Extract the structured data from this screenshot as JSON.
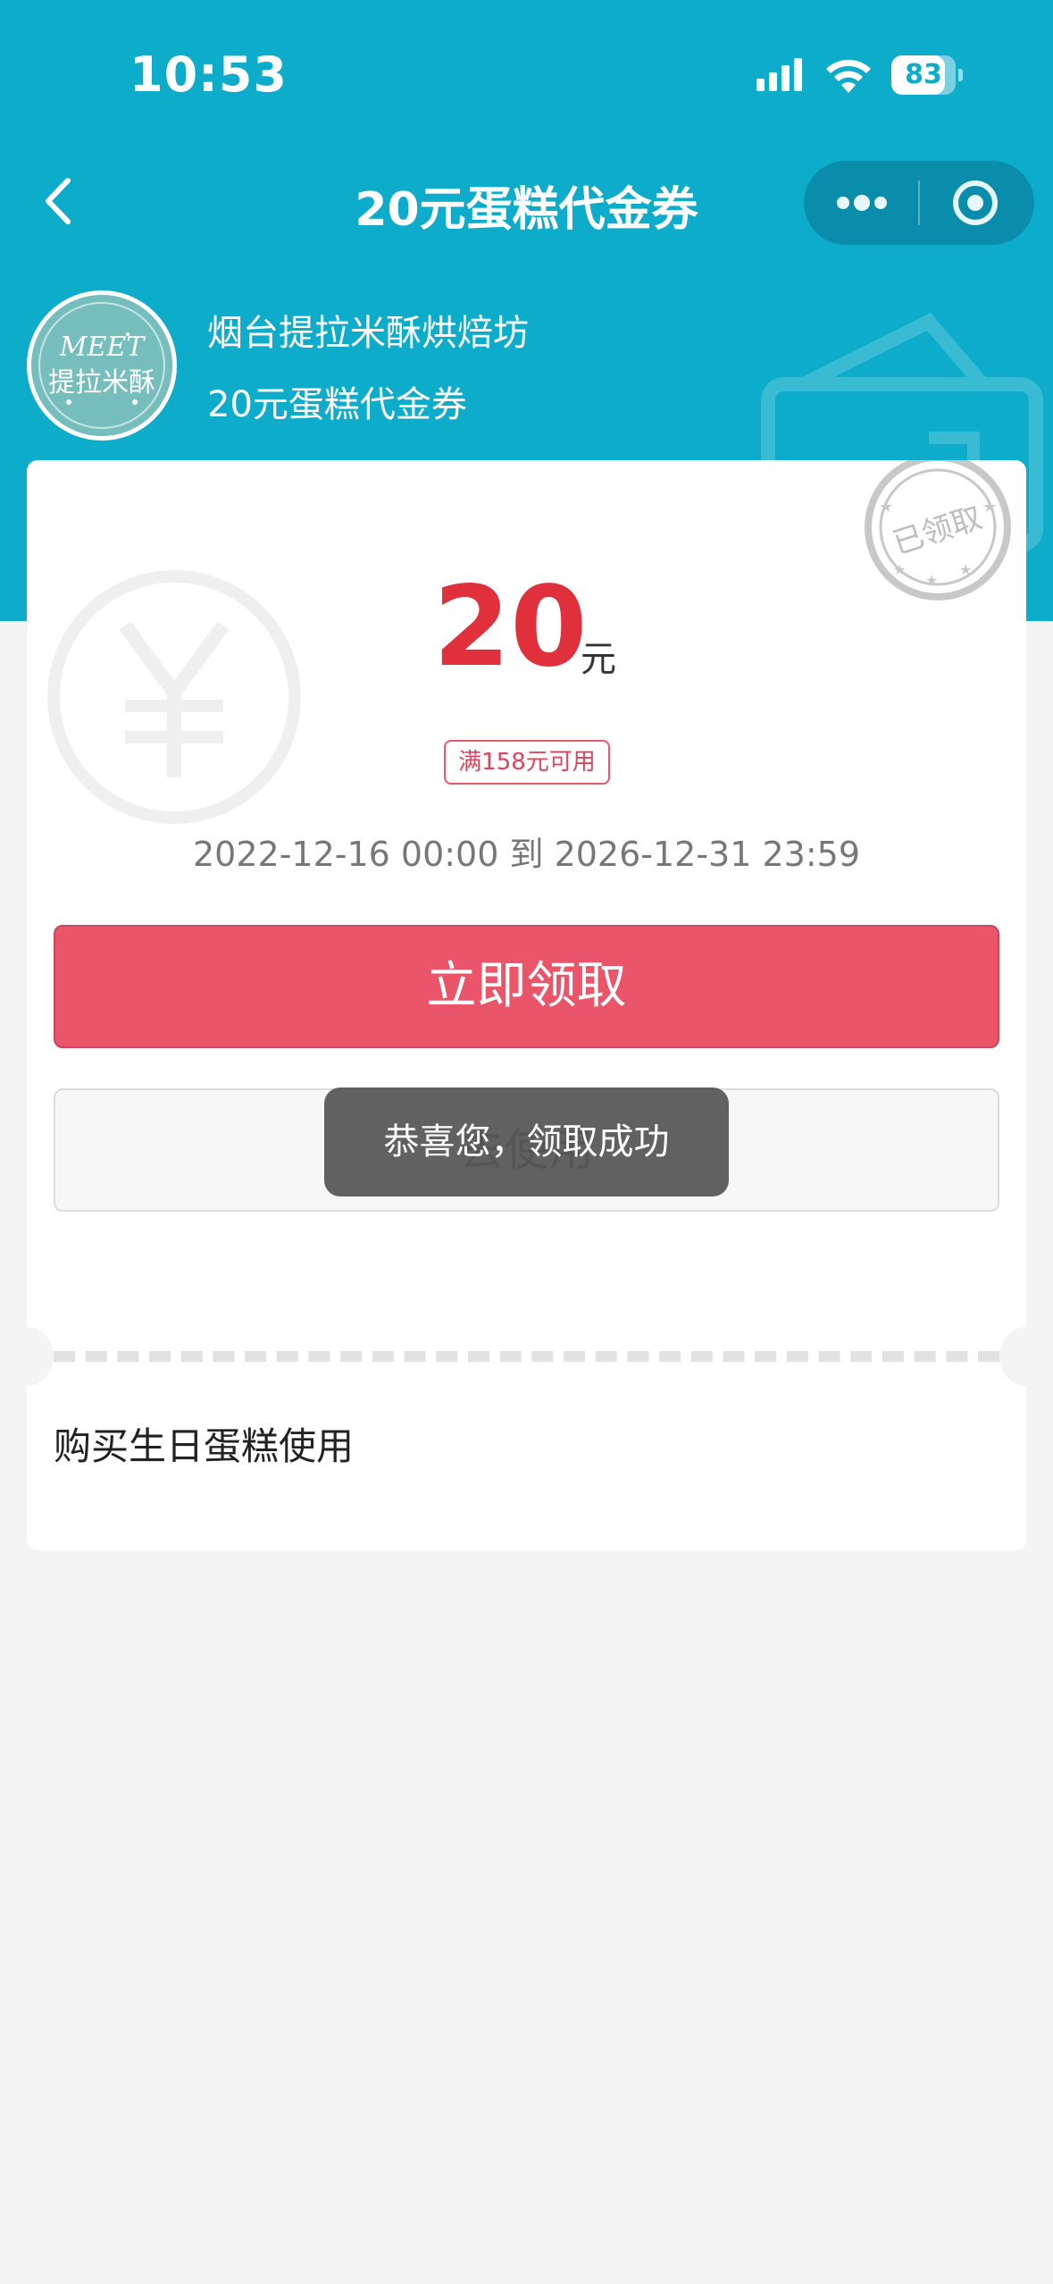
{
  "status_bar": {
    "time": "10:53",
    "battery_level": "83",
    "battery_fraction": 0.83
  },
  "nav": {
    "title": "20元蛋糕代金券",
    "back_icon": "chevron-left-icon",
    "more_icon": "more-dots-icon",
    "close_icon": "target-circle-icon"
  },
  "shop": {
    "name": "烟台提拉米酥烘焙坊",
    "subtitle": "20元蛋糕代金券",
    "logo_text": "MEET 提拉米酥"
  },
  "coupon": {
    "amount": "20",
    "unit": "元",
    "condition": "满158元可用",
    "validity": "2022-12-16 00:00 到 2026-12-31 23:59",
    "stamp_text": "已领取",
    "claim_label": "立即领取",
    "use_label": "去使用",
    "usage_description": "购买生日蛋糕使用"
  },
  "toast": {
    "message": "恭喜您，领取成功"
  },
  "colors": {
    "header_bg": "#0daccb",
    "amount_red": "#e0303c",
    "claim_button": "#ea556a",
    "page_bg": "#f4f4f4"
  }
}
